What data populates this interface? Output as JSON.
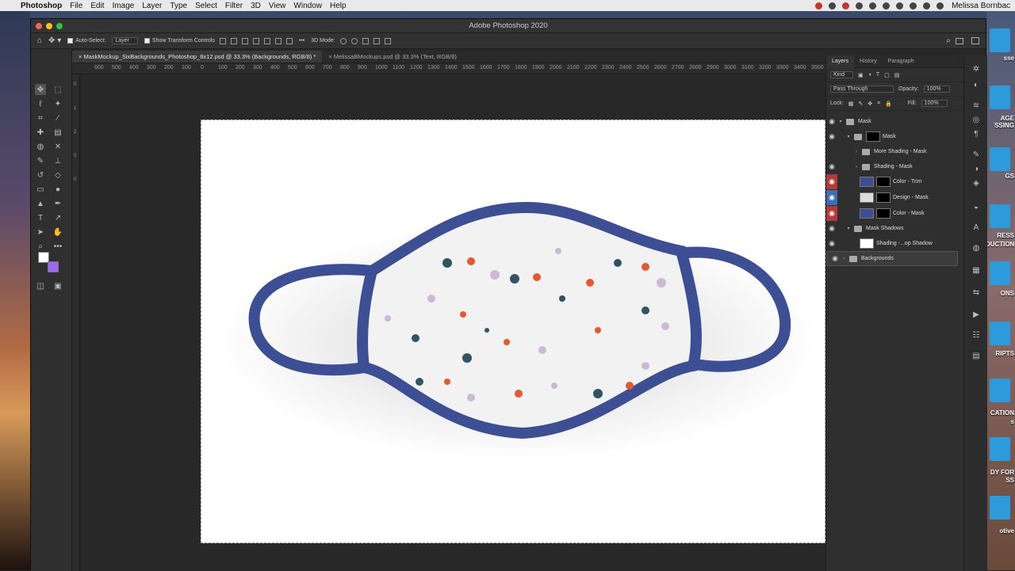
{
  "menubar": {
    "apple": "",
    "app": "Photoshop",
    "items": [
      "File",
      "Edit",
      "Image",
      "Layer",
      "Type",
      "Select",
      "Filter",
      "3D",
      "View",
      "Window",
      "Help"
    ],
    "user": "Melissa Bornbac"
  },
  "window": {
    "title": "Adobe Photoshop 2020"
  },
  "options": {
    "auto_select": "Auto-Select:",
    "auto_select_target": "Layer",
    "show_transform": "Show Transform Controls",
    "mode_3d": "3D Mode:",
    "more": "•••"
  },
  "tabs": [
    {
      "label": "MaskMockup_SixBackgrounds_Photoshop_8x12.psd @ 33.3% (Backgrounds, RGB/8) *"
    },
    {
      "label": "MelissaBMockups.psd @ 33.3% (Text, RGB/8)"
    }
  ],
  "ruler": [
    "600",
    "500",
    "400",
    "300",
    "200",
    "100",
    "0",
    "100",
    "200",
    "300",
    "400",
    "500",
    "600",
    "700",
    "800",
    "900",
    "1000",
    "1100",
    "1200",
    "1300",
    "1400",
    "1500",
    "1600",
    "1700",
    "1800",
    "1900",
    "2000",
    "2100",
    "2200",
    "2300",
    "2400",
    "2500",
    "2600",
    "2700",
    "2800",
    "2900",
    "3000",
    "3100",
    "3200",
    "3300",
    "3400",
    "3500"
  ],
  "vruler": [
    "0",
    "1",
    "2",
    "0",
    "0"
  ],
  "panel": {
    "tabs": [
      "Layers",
      "History",
      "Paragraph"
    ],
    "kind": "Kind",
    "blend": "Pass Through",
    "opacity_label": "Opacity:",
    "opacity": "100%",
    "lock_label": "Lock:",
    "fill_label": "Fill:",
    "fill": "100%",
    "layers": [
      {
        "name": "Mask",
        "indent": 0,
        "type": "folder",
        "eye": "normal"
      },
      {
        "name": "Mask",
        "indent": 1,
        "type": "masked-folder",
        "eye": "normal"
      },
      {
        "name": "More Shading - Mask",
        "indent": 2,
        "type": "folder",
        "eye": "none"
      },
      {
        "name": "Shading - Mask",
        "indent": 2,
        "type": "folder",
        "eye": "normal"
      },
      {
        "name": "Color - Trim",
        "indent": 2,
        "type": "layer",
        "eye": "red"
      },
      {
        "name": "Design - Mask",
        "indent": 2,
        "type": "layer",
        "eye": "blue"
      },
      {
        "name": "Color - Mask",
        "indent": 2,
        "type": "layer",
        "eye": "red"
      },
      {
        "name": "Mask Shadows",
        "indent": 1,
        "type": "folder",
        "eye": "normal"
      },
      {
        "name": "Shading -...op Shadow",
        "indent": 2,
        "type": "layer",
        "eye": "normal"
      },
      {
        "name": "Backgrounds",
        "indent": 0,
        "type": "folder",
        "eye": "normal",
        "selected": true
      }
    ]
  },
  "desktop": [
    "sse",
    "AGE",
    "SSING",
    "GS",
    "RESS",
    "DUCTION",
    "ONS",
    "RIPTS",
    "CATION",
    "s",
    "DY FOR",
    "SS",
    "otive"
  ],
  "colors": {
    "mask_trim": "#3d4f94",
    "dot_orange": "#e8582c",
    "dot_teal": "#2f5563",
    "dot_lilac": "#cdb8d8",
    "fg": "#ffffff",
    "bg": "#a066ff"
  }
}
